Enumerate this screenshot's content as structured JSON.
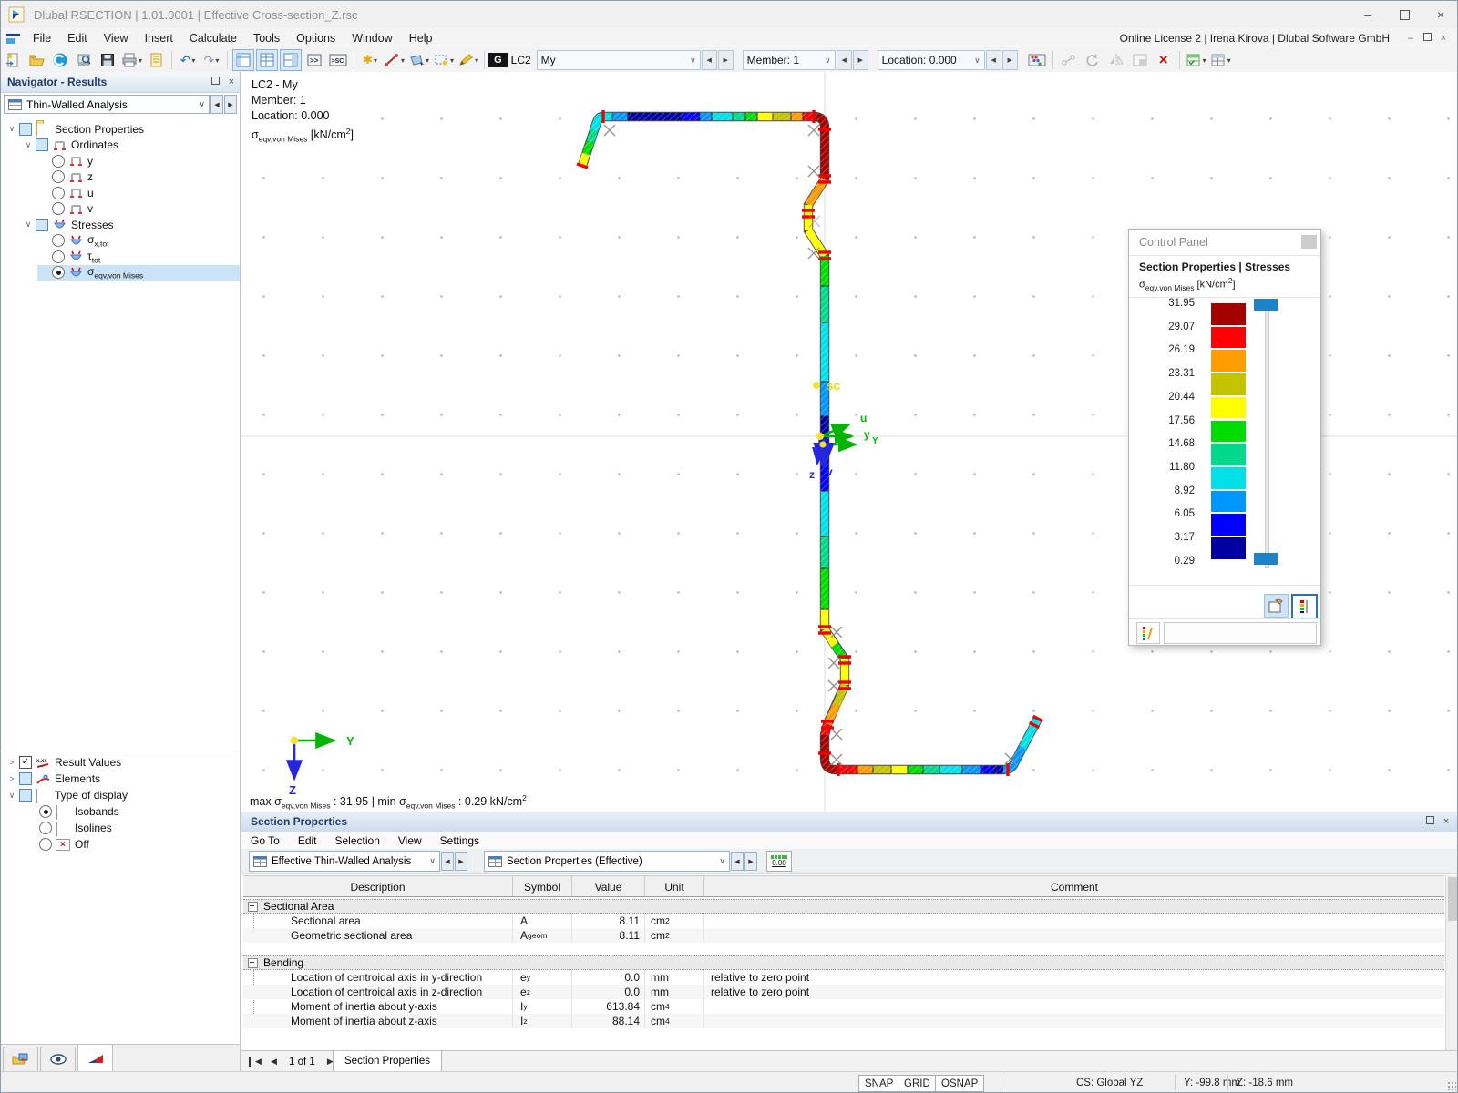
{
  "window": {
    "title": "Dlubal RSECTION | 1.01.0001 | Effective Cross-section_Z.rsc",
    "license": "Online License 2 | Irena Kirova | Dlubal Software GmbH"
  },
  "menubar": {
    "items": [
      "File",
      "Edit",
      "View",
      "Insert",
      "Calculate",
      "Tools",
      "Options",
      "Window",
      "Help"
    ]
  },
  "glyphs": {
    "caret": "▾",
    "chevron_down": "∨",
    "chevron_right": ">",
    "left": "◀",
    "right": "▶",
    "close": "×",
    "minimize": "–",
    "check": "✓",
    "undo": "↶",
    "redo": "↷",
    "console": ">>",
    "sc_values": ">SC",
    "star": "✱",
    "delete_x": "×"
  },
  "toolbar": {
    "g_badge": "G",
    "lc_label": "LC2",
    "lc_value": "My",
    "member": "Member: 1",
    "location": "Location: 0.000"
  },
  "navigator": {
    "title": "Navigator - Results",
    "combo": "Thin-Walled Analysis",
    "items": {
      "section_properties": "Section Properties",
      "ordinates": "Ordinates",
      "y": "y",
      "z": "z",
      "u": "u",
      "v": "v",
      "stresses": "Stresses",
      "sigma_x_base": "σ",
      "sigma_x_sub": "x,tot",
      "tau_base": "τ",
      "tau_sub": "tot",
      "sigma_eqv_base": "σ",
      "sigma_eqv_sub": "eqv,von Mises"
    },
    "display": {
      "result_values": "Result Values",
      "elements": "Elements",
      "type_of_display": "Type of display",
      "isobands": "Isobands",
      "isolines": "Isolines",
      "off": "Off"
    }
  },
  "canvas": {
    "info_line1": "LC2 - My",
    "info_line2": "Member: 1",
    "info_line3": "Location: 0.000",
    "stress_sigma": "σ",
    "stress_sub": "eqv,von Mises",
    "stress_unit_pre": " [kN/cm",
    "stress_unit_sup": "2",
    "stress_unit_post": "]",
    "max_pre": "max σ",
    "max_sub": "eqv,von Mises",
    "max_mid": " : 31.95 | min σ",
    "min_sub": "eqv,von Mises",
    "min_post": " : 0.29 kN/cm",
    "min_sup": "2",
    "axis_u": "u",
    "axis_y": "y",
    "axis_Y2": "Y",
    "axis_z": "z",
    "axis_v": "v",
    "sc": "SC",
    "triad_y": "Y",
    "triad_z": "Z"
  },
  "control_panel": {
    "title": "Control Panel",
    "heading": "Section Properties | Stresses",
    "sigma": "σ",
    "sigma_sub": "eqv,von Mises",
    "unit_pre": " [kN/cm",
    "unit_sup": "2",
    "unit_post": "]",
    "scale_labels": [
      "31.95",
      "29.07",
      "26.19",
      "23.31",
      "20.44",
      "17.56",
      "14.68",
      "11.80",
      "8.92",
      "6.05",
      "3.17",
      "0.29"
    ],
    "scale_colors": [
      "#a50000",
      "#ff0000",
      "#ff9c00",
      "#c3c300",
      "#ffff00",
      "#00dc00",
      "#00d98c",
      "#00e0e6",
      "#0096ff",
      "#0000ff",
      "#0000a0"
    ]
  },
  "sp": {
    "title": "Section Properties",
    "menus": [
      "Go To",
      "Edit",
      "Selection",
      "View",
      "Settings"
    ],
    "combo1": "Effective Thin-Walled Analysis",
    "combo2": "Section Properties (Effective)",
    "decimals": "0.00",
    "headers": [
      "Description",
      "Symbol",
      "Value",
      "Unit",
      "Comment"
    ],
    "group1": "Sectional Area",
    "group2": "Bending",
    "rows": [
      {
        "desc": "Sectional area",
        "sym": "A",
        "sub": "",
        "val": "8.11",
        "unit": "cm",
        "usup": "2",
        "comment": ""
      },
      {
        "desc": "Geometric sectional area",
        "sym": "A",
        "sub": "geom",
        "val": "8.11",
        "unit": "cm",
        "usup": "2",
        "comment": ""
      },
      {
        "desc": "Location of centroidal axis in y-direction",
        "sym": "e",
        "sub": "y",
        "val": "0.0",
        "unit": "mm",
        "usup": "",
        "comment": "relative to zero point"
      },
      {
        "desc": "Location of centroidal axis in z-direction",
        "sym": "e",
        "sub": "z",
        "val": "0.0",
        "unit": "mm",
        "usup": "",
        "comment": "relative to zero point"
      },
      {
        "desc": "Moment of inertia about y-axis",
        "sym": "I",
        "sub": "y",
        "val": "613.84",
        "unit": "cm",
        "usup": "4",
        "comment": ""
      },
      {
        "desc": "Moment of inertia about z-axis",
        "sym": "I",
        "sub": "z",
        "val": "88.14",
        "unit": "cm",
        "usup": "4",
        "comment": ""
      }
    ],
    "pager": "1 of 1",
    "tab": "Section Properties"
  },
  "status": {
    "snap": "SNAP",
    "grid": "GRID",
    "osnap": "OSNAP",
    "cs": "CS: Global YZ",
    "y": "Y: -99.8 mm",
    "z": "Z: -18.6 mm"
  }
}
